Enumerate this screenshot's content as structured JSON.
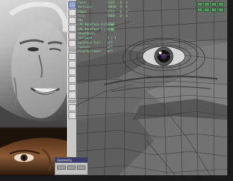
{
  "viewport": {
    "stats": [
      {
        "label": "Faces",
        "value": "5240",
        "c1": "0",
        "c2": "0"
      },
      {
        "label": "Vertices",
        "value": "18036",
        "c1": "0",
        "c2": "0"
      },
      {
        "label": "Edges",
        "value": "5772",
        "c1": "0",
        "c2": "0"
      },
      {
        "label": "Tris",
        "value": "5980",
        "c1": "0",
        "c2": "0"
      },
      {
        "label": "UVs",
        "value": "",
        "c1": "",
        "c2": ""
      },
      {
        "label": "CPU Backface Culling",
        "value": "1236",
        "c1": "",
        "c2": ""
      },
      {
        "label": "GPU Backface Culling",
        "value": "1236",
        "c1": "",
        "c2": ""
      },
      {
        "label": "Smoothness",
        "value": "",
        "c1": "",
        "c2": ""
      },
      {
        "label": "Instance",
        "value": "1 / 1",
        "c1": "",
        "c2": ""
      },
      {
        "label": "Backface Cull",
        "value": "off",
        "c1": "",
        "c2": ""
      },
      {
        "label": "Texture",
        "value": "off",
        "c1": "",
        "c2": ""
      },
      {
        "label": "Display Layer",
        "value": "off",
        "c1": "",
        "c2": ""
      }
    ]
  },
  "panel": {
    "title": "Geometry"
  }
}
